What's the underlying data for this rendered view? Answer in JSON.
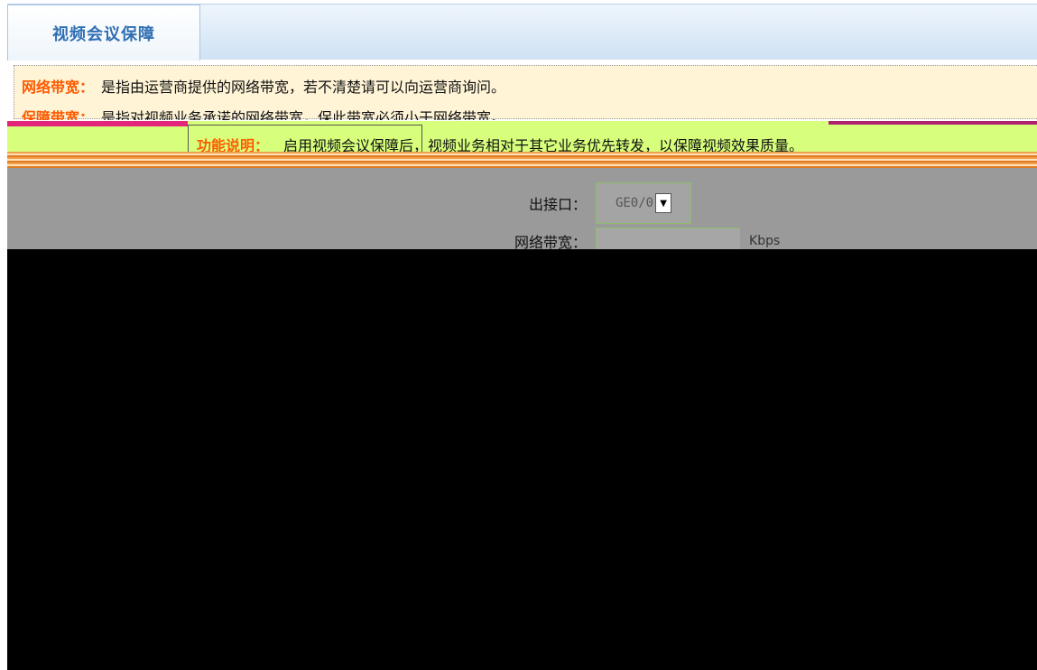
{
  "tab": {
    "label": "视频会议保障"
  },
  "note": {
    "items": [
      {
        "key": "网络带宽：",
        "text": "是指由运营商提供的网络带宽，若不清楚请可以向运营商询问。"
      },
      {
        "key": "保障带宽：",
        "text": "是指对视频业务承诺的网络带宽，保此带宽必须小于网络带宽。"
      }
    ]
  },
  "feature": {
    "key": "功能说明：",
    "text": "启用视频会议保障后，视频业务相对于其它业务优先转发，以保障视频效果质量。"
  },
  "form": {
    "interface_label": "出接口：",
    "interface_value": "GE0/0",
    "bandwidth_label": "网络带宽：",
    "bandwidth_unit": "Kbps"
  }
}
